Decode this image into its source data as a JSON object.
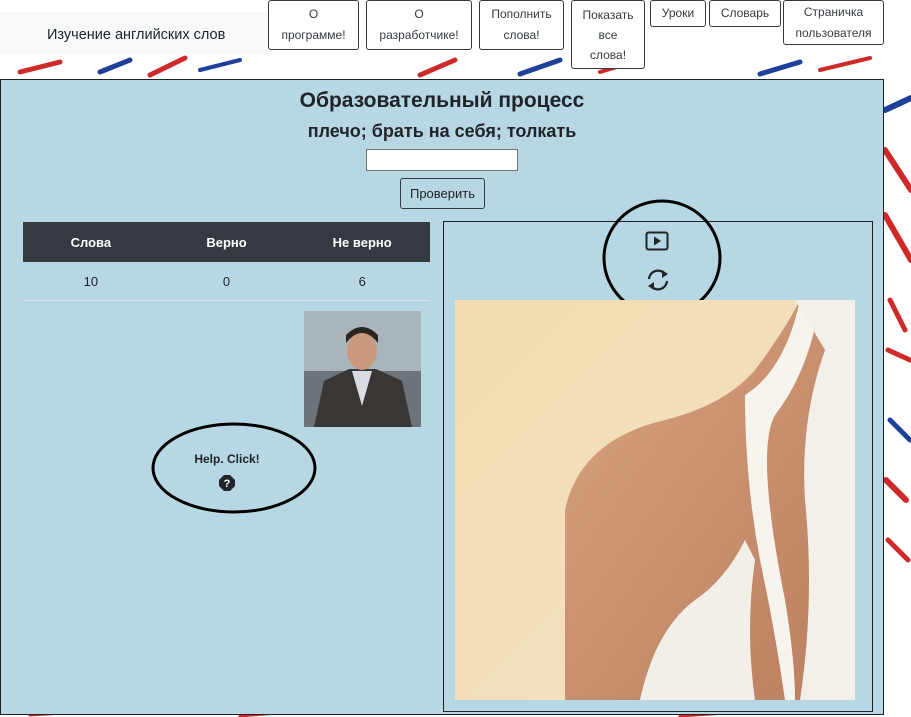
{
  "navbar": {
    "brand": "Изучение английских слов",
    "buttons": [
      {
        "lines": [
          "О",
          "программе!"
        ]
      },
      {
        "lines": [
          "О",
          "разработчике!"
        ]
      },
      {
        "lines": [
          "Пополнить",
          "слова!"
        ]
      },
      {
        "lines": [
          "Показать",
          "все",
          "слова!"
        ]
      },
      {
        "lines": [
          "Уроки"
        ]
      },
      {
        "lines": [
          "Словарь"
        ]
      },
      {
        "lines": [
          "Страничка",
          "пользователя"
        ]
      }
    ]
  },
  "main": {
    "title": "Образовательный процесс",
    "word": "плечо; брать на себя; толкать",
    "answer": {
      "value": "",
      "placeholder": ""
    },
    "check_label": "Проверить"
  },
  "stats": {
    "headers": [
      "Слова",
      "Верно",
      "Не верно"
    ],
    "row": [
      "10",
      "0",
      "6"
    ]
  },
  "help": {
    "text": "Help. Click!",
    "icon": "question-icon"
  },
  "media": {
    "play_icon": "play-icon",
    "refresh_icon": "refresh-icon"
  },
  "colors": {
    "panel_bg": "#b6d7e3",
    "table_header": "#343a40",
    "flag_red": "#cf2a2a",
    "flag_blue": "#1e3f9a"
  }
}
